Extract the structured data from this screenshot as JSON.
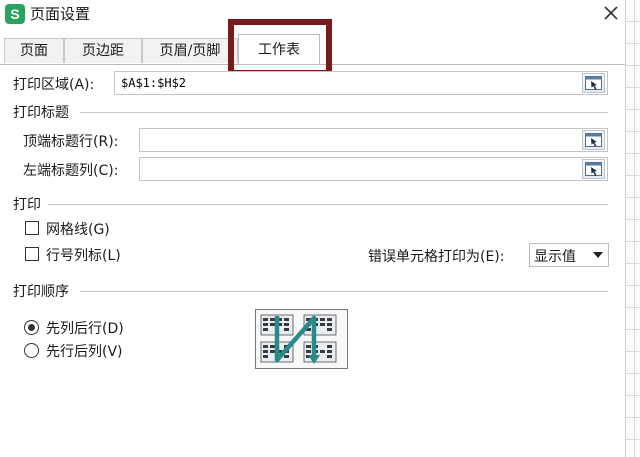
{
  "window": {
    "logo_letter": "S",
    "title": "页面设置"
  },
  "tabs": [
    {
      "label": "页面",
      "active": false
    },
    {
      "label": "页边距",
      "active": false
    },
    {
      "label": "页眉/页脚",
      "active": false
    },
    {
      "label": "工作表",
      "active": true
    }
  ],
  "print_area": {
    "label": "打印区域(A):",
    "value": "$A$1:$H$2"
  },
  "print_titles": {
    "section": "打印标题",
    "top_rows_label": "顶端标题行(R):",
    "top_rows_value": "",
    "left_cols_label": "左端标题列(C):",
    "left_cols_value": ""
  },
  "print": {
    "section": "打印",
    "gridlines_label": "网格线(G)",
    "gridlines_checked": false,
    "row_col_headings_label": "行号列标(L)",
    "row_col_headings_checked": false,
    "cell_errors_label": "错误单元格打印为(E):",
    "cell_errors_value": "显示值"
  },
  "page_order": {
    "section": "打印顺序",
    "options": [
      {
        "label": "先列后行(D)",
        "checked": true
      },
      {
        "label": "先行后列(V)",
        "checked": false
      }
    ]
  },
  "colors": {
    "highlight": "#7a1a1a",
    "brand": "#2aa45a",
    "order_arrow": "#2a8a8a"
  }
}
